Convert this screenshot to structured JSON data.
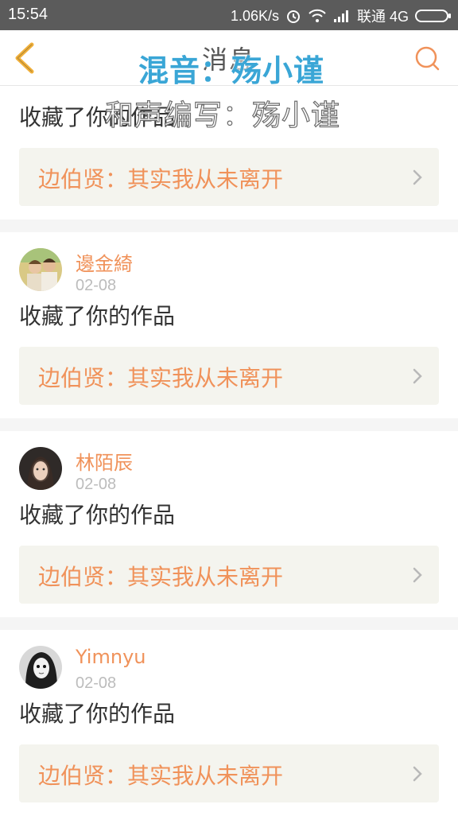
{
  "status_bar": {
    "time": "15:54",
    "speed": "1.06K/s",
    "carrier": "联通 4G"
  },
  "nav": {
    "title": "消息",
    "overlay_text": "混音：殇小谨"
  },
  "overlay_bottom": "和声编写：殇小谨",
  "colors": {
    "accent": "#f0925a",
    "overlay_blue": "#3aa6d6",
    "work_bg": "#f4f4ee"
  },
  "feed": {
    "items": [
      {
        "action": "收藏了你的作品",
        "work_title": "边伯贤：其实我从未离开"
      },
      {
        "user": "邊金綺",
        "date": "02-08",
        "action": "收藏了你的作品",
        "work_title": "边伯贤：其实我从未离开"
      },
      {
        "user": "林陌辰",
        "date": "02-08",
        "action": "收藏了你的作品",
        "work_title": "边伯贤：其实我从未离开"
      },
      {
        "user": "Yimnyu",
        "date": "02-08",
        "action": "收藏了你的作品",
        "work_title": "边伯贤：其实我从未离开"
      }
    ]
  }
}
